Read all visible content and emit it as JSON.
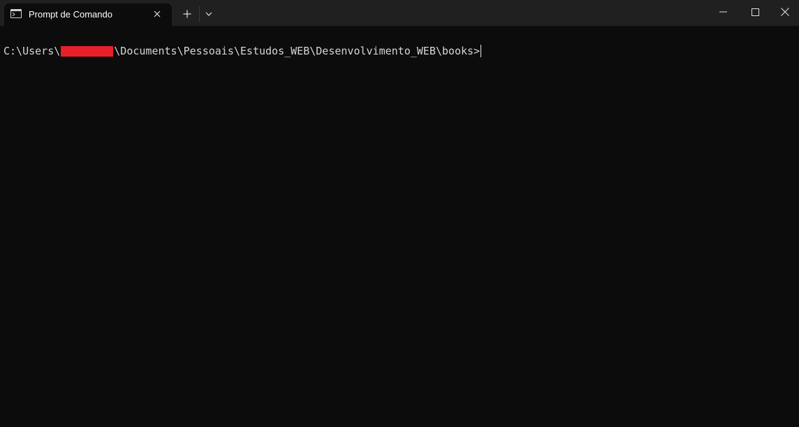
{
  "window": {
    "tab_title": "Prompt de Comando",
    "tab_icon": "terminal-icon",
    "controls": [
      "minimize-icon",
      "maximize-icon",
      "close-icon"
    ]
  },
  "terminal": {
    "prompt_prefix": "C:\\Users\\",
    "prompt_suffix": "\\Documents\\Pessoais\\Estudos_WEB\\Desenvolvimento_WEB\\books>",
    "redaction_color": "#e8202a"
  },
  "colors": {
    "titlebar": "#202020",
    "background": "#0c0c0c",
    "text": "#d6d6d6"
  }
}
